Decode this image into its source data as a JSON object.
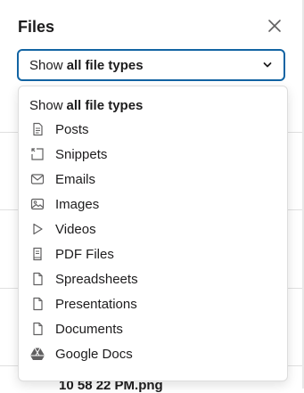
{
  "panel": {
    "title": "Files",
    "close_icon": "close-icon"
  },
  "filter": {
    "prefix": "Show ",
    "value": "all file types",
    "icon": "chevron-down-icon"
  },
  "menu": {
    "header_prefix": "Show ",
    "header_value": "all file types",
    "items": [
      {
        "label": "Posts",
        "icon": "post-icon"
      },
      {
        "label": "Snippets",
        "icon": "snippet-icon"
      },
      {
        "label": "Emails",
        "icon": "email-icon"
      },
      {
        "label": "Images",
        "icon": "image-icon"
      },
      {
        "label": "Videos",
        "icon": "video-icon"
      },
      {
        "label": "PDF Files",
        "icon": "pdf-icon"
      },
      {
        "label": "Spreadsheets",
        "icon": "spreadsheet-icon"
      },
      {
        "label": "Presentations",
        "icon": "presentation-icon"
      },
      {
        "label": "Documents",
        "icon": "document-icon"
      },
      {
        "label": "Google Docs",
        "icon": "google-drive-icon"
      }
    ]
  },
  "background": {
    "partial_filename": "10 58 22 PM.png"
  },
  "colors": {
    "focus_border": "#1264a3",
    "text": "#1d1c1d",
    "icon": "#616061"
  }
}
